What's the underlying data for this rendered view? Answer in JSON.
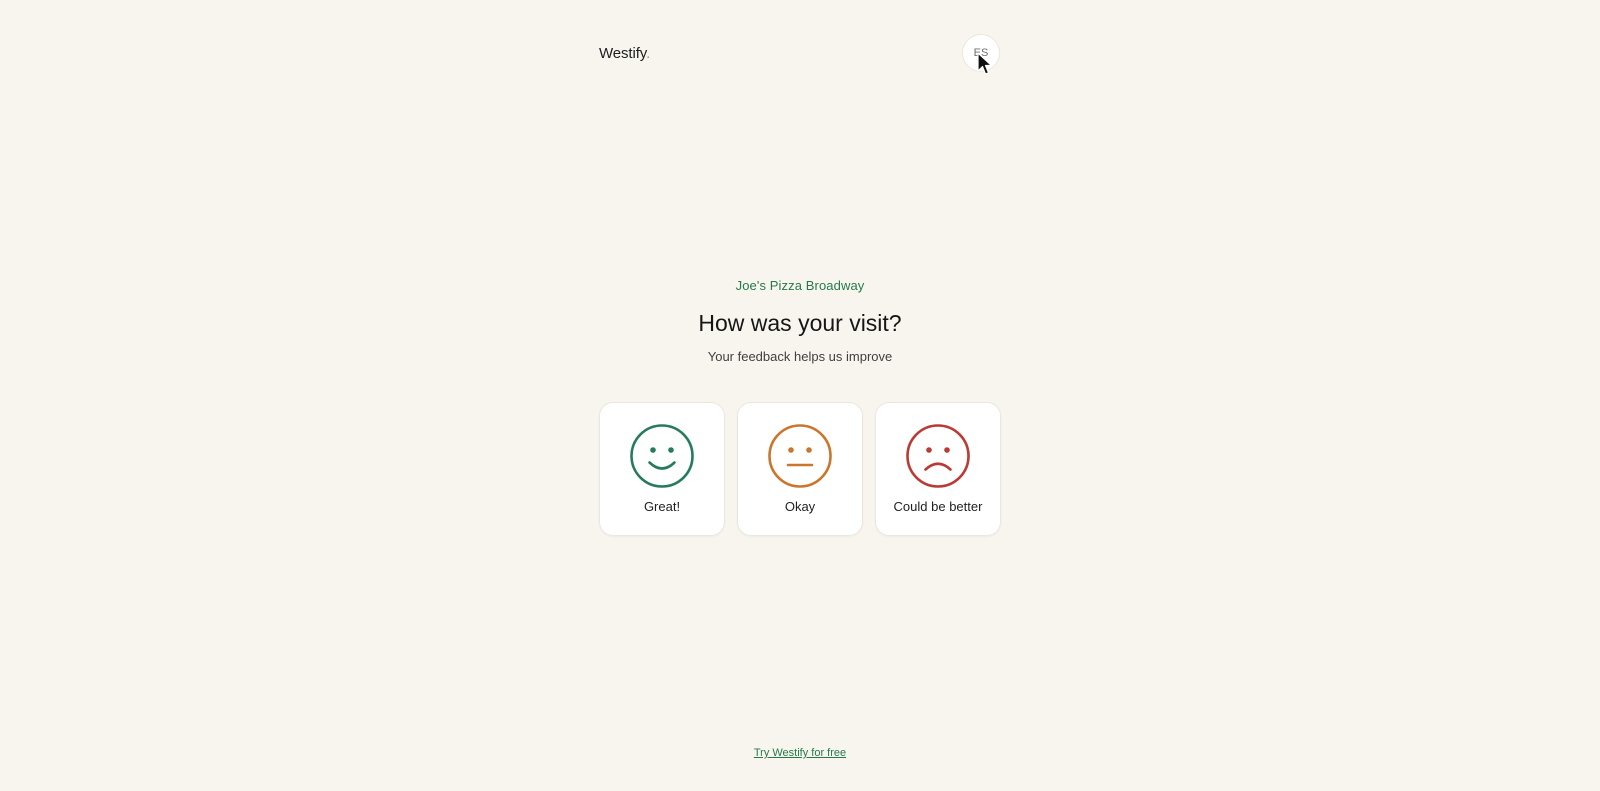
{
  "header": {
    "logo_text": "Westify",
    "logo_dot": ".",
    "language_label": "ES"
  },
  "main": {
    "restaurant_name": "Joe's Pizza Broadway",
    "question": "How was your visit?",
    "subtitle": "Your feedback helps us improve"
  },
  "options": [
    {
      "label": "Great!",
      "icon": "smile-face-icon",
      "color": "#267a5e"
    },
    {
      "label": "Okay",
      "icon": "neutral-face-icon",
      "color": "#c9772f"
    },
    {
      "label": "Could be better",
      "icon": "sad-face-icon",
      "color": "#b83b35"
    }
  ],
  "footer": {
    "link_text": "Try Westify for free"
  },
  "colors": {
    "background": "#f8f5ef",
    "accent_green": "#267a4b"
  }
}
